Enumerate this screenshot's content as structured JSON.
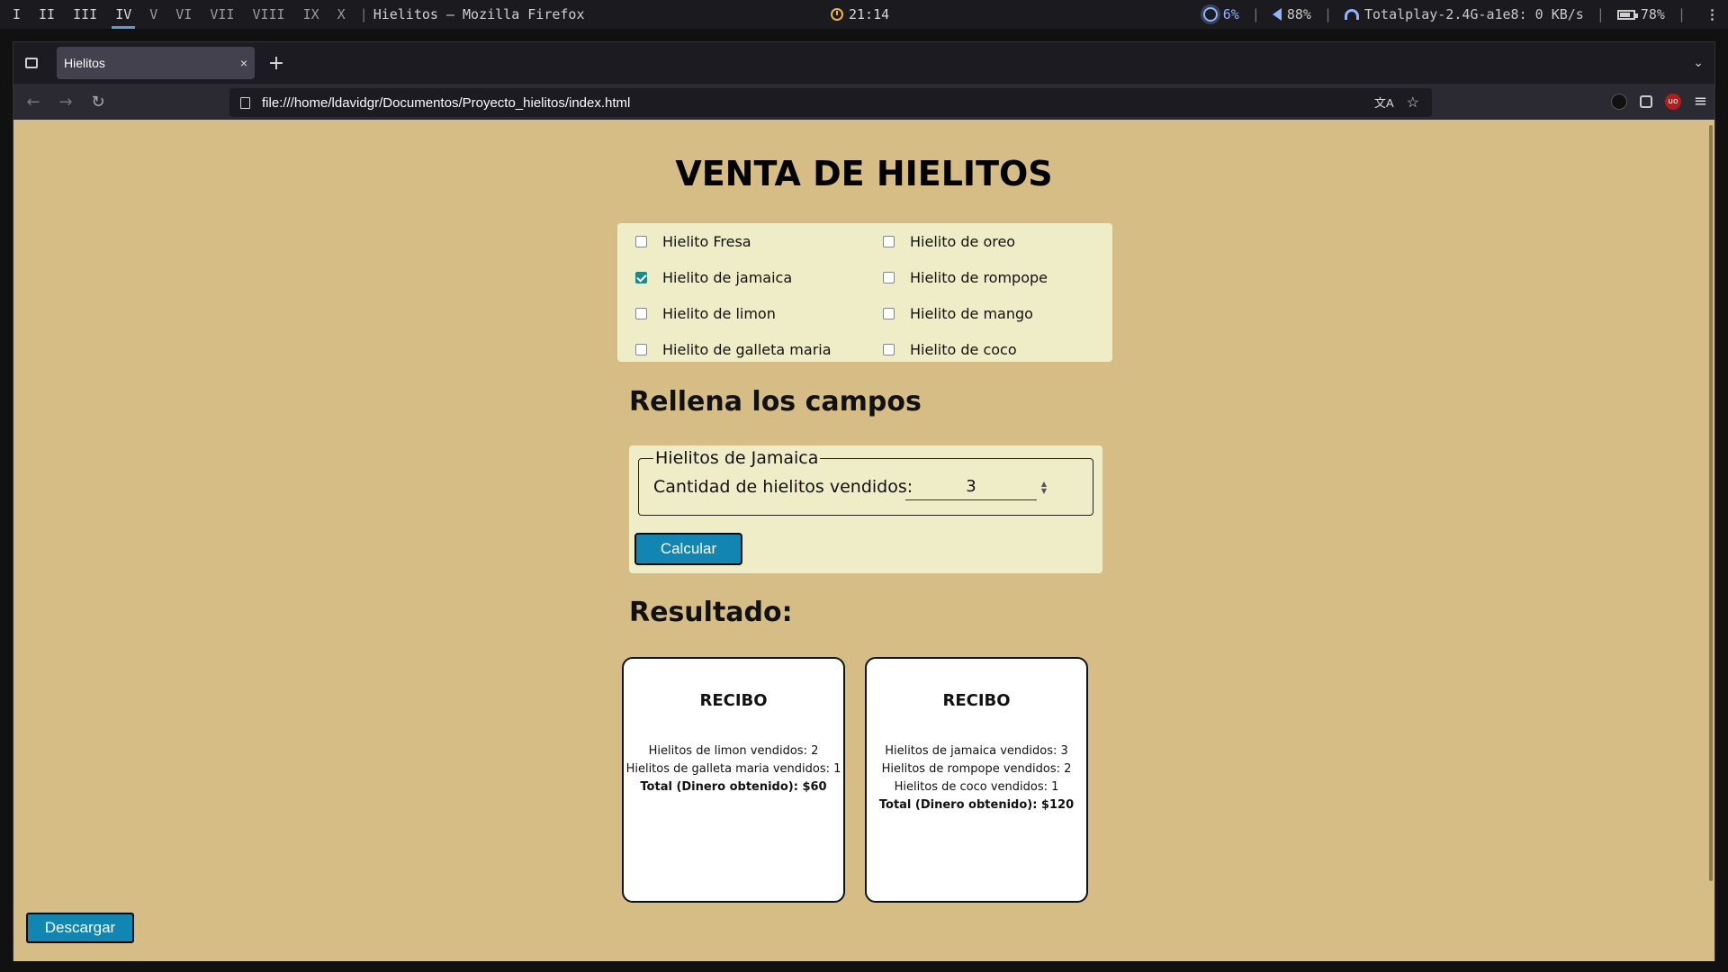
{
  "system_bar": {
    "workspaces": [
      "I",
      "II",
      "III",
      "IV",
      "V",
      "VI",
      "VII",
      "VIII",
      "IX",
      "X"
    ],
    "active_workspace": "IV",
    "window_title": "Hielitos — Mozilla Firefox",
    "clock": "21:14",
    "brightness": "6%",
    "volume": "88%",
    "network": "Totalplay-2.4G-a1e8: 0 KB/s",
    "battery": "78%",
    "separator": "|"
  },
  "browser": {
    "tab_title": "Hielitos",
    "tab_close": "×",
    "new_tab": "+",
    "overflow": "⌄",
    "back": "←",
    "forward": "→",
    "reload": "↻",
    "url": "file:///home/ldavidgr/Documentos/Proyecto_hielitos/index.html",
    "translate_icon": "文A",
    "bookmark_icon": "☆",
    "menu_icon": "≡"
  },
  "page": {
    "title": "VENTA DE HIELITOS",
    "products": [
      {
        "label": "Hielito Fresa",
        "checked": false
      },
      {
        "label": "Hielito de jamaica",
        "checked": true
      },
      {
        "label": "Hielito de limon",
        "checked": false
      },
      {
        "label": "Hielito de galleta maria",
        "checked": false
      },
      {
        "label": "Hielito de oreo",
        "checked": false
      },
      {
        "label": "Hielito de rompope",
        "checked": false
      },
      {
        "label": "Hielito de mango",
        "checked": false
      },
      {
        "label": "Hielito de coco",
        "checked": false
      }
    ],
    "fill_title": "Rellena los campos",
    "form": {
      "legend": "Hielitos de Jamaica",
      "quantity_label": "Cantidad de hielitos vendidos:",
      "quantity_value": "3",
      "calculate_label": "Calcular"
    },
    "result_title": "Resultado:",
    "receipts": [
      {
        "title": "RECIBO",
        "lines": [
          "Hielitos de limon vendidos: 2",
          "Hielitos de galleta maria vendidos: 1"
        ],
        "total": "Total (Dinero obtenido): $60"
      },
      {
        "title": "RECIBO",
        "lines": [
          "Hielitos de jamaica vendidos: 3",
          "Hielitos de rompope vendidos: 2",
          "Hielitos de coco vendidos: 1"
        ],
        "total": "Total (Dinero obtenido): $120"
      }
    ],
    "download_label": "Descargar"
  },
  "colors": {
    "page_background": "#d6bd85",
    "panel_background": "#efecc8",
    "button_blue": "#1286b3",
    "checkbox_checked": "#1a8a8a"
  }
}
